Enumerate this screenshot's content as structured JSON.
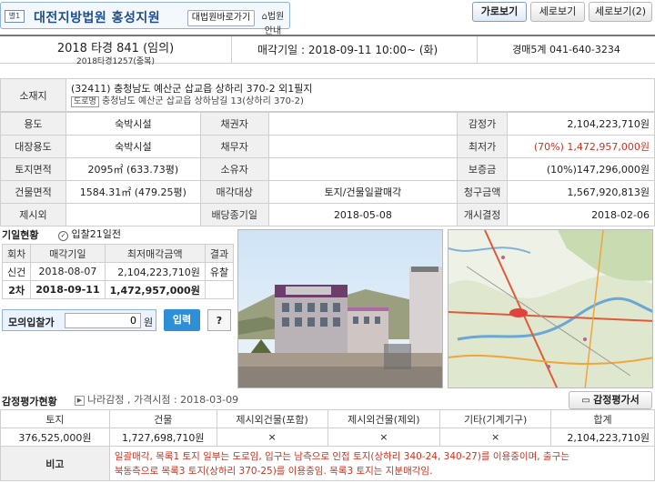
{
  "header": {
    "badge": "별1",
    "court_name": "대전지방법원 홍성지원",
    "court_home_btn": "대법원바로가기",
    "court_info_btn": "법원안내",
    "view_buttons": [
      "가로보기",
      "세로보기",
      "세로보기(2)"
    ]
  },
  "case": {
    "number": "2018 타경 841 (임의)",
    "sub_number": "2018타경1257(중복)",
    "sale_date": "매각기일 : 2018-09-11 10:00~ (화)",
    "dept": "경매5계 041-640-3234"
  },
  "location": {
    "label": "소재지",
    "address": "(32411) 충청남도 예산군 삽교읍 상하리 370-2 외1필지",
    "road_tag": "도로명",
    "road_address": "충청남도 예산군 삽교읍 상하남길 13(상하리 370-2)"
  },
  "info_rows": [
    {
      "l1": "용도",
      "v1": "숙박시설",
      "l2": "채권자",
      "v2": "",
      "l3": "감정가",
      "v3": "2,104,223,710원"
    },
    {
      "l1": "대장용도",
      "v1": "숙박시설",
      "l2": "채무자",
      "v2": "",
      "l3": "최저가",
      "v3": "(70%) 1,472,957,000원"
    },
    {
      "l1": "토지면적",
      "v1": "2095㎡ (633.73평)",
      "l2": "소유자",
      "v2": "",
      "l3": "보증금",
      "v3": "(10%)147,296,000원"
    },
    {
      "l1": "건물면적",
      "v1": "1584.31㎡ (479.25평)",
      "l2": "매각대상",
      "v2": "토지/건물일괄매각",
      "l3": "청구금액",
      "v3": "1,567,920,813원"
    },
    {
      "l1": "제시외",
      "v1": "",
      "l2": "배당종기일",
      "v2": "2018-05-08",
      "l3": "개시결정",
      "v3": "2018-02-06"
    }
  ],
  "history": {
    "title": "기일현황",
    "d_day": "입찰21일전",
    "headers": [
      "회차",
      "매각기일",
      "최저매각금액",
      "결과"
    ],
    "rows": [
      {
        "round": "신건",
        "date": "2018-08-07",
        "price": "2,104,223,710원",
        "result": "유찰"
      },
      {
        "round": "2차",
        "date": "2018-09-11",
        "price": "1,472,957,000원",
        "result": ""
      }
    ]
  },
  "mock_bid": {
    "label": "모의입찰가",
    "value": "0",
    "unit": "원",
    "submit": "입력",
    "help": "?"
  },
  "appraisal": {
    "title": "감정평가현황",
    "source": "나라감정 , 가격시점 : 2018-03-09",
    "report_btn": "감정평가서",
    "headers": [
      "토지",
      "건물",
      "제시외건물(포함)",
      "제시외건물(제외)",
      "기타(기계기구)",
      "합계"
    ],
    "values": [
      "376,525,000원",
      "1,727,698,710원",
      "×",
      "×",
      "×",
      "2,104,223,710원"
    ],
    "note_label": "비고",
    "note_line1": "일괄매각, 목록1 토지 일부는 도로임, 입구는 남측으로 인접 토지(상하리 340-24, 340-27)를 이용중이며, 출구는",
    "note_line2": "북동측으로 목록3 토지(상하리 370-25)를 이용중임. 목록3 토지는 지분매각임."
  },
  "colors": {
    "accent_blue": "#1f4e8c",
    "note_red": "#d0311f",
    "min_price_red": "#d0311f",
    "mock_bid_bg": "#eaf3ff",
    "submit_blue": "#2f8fd6"
  }
}
